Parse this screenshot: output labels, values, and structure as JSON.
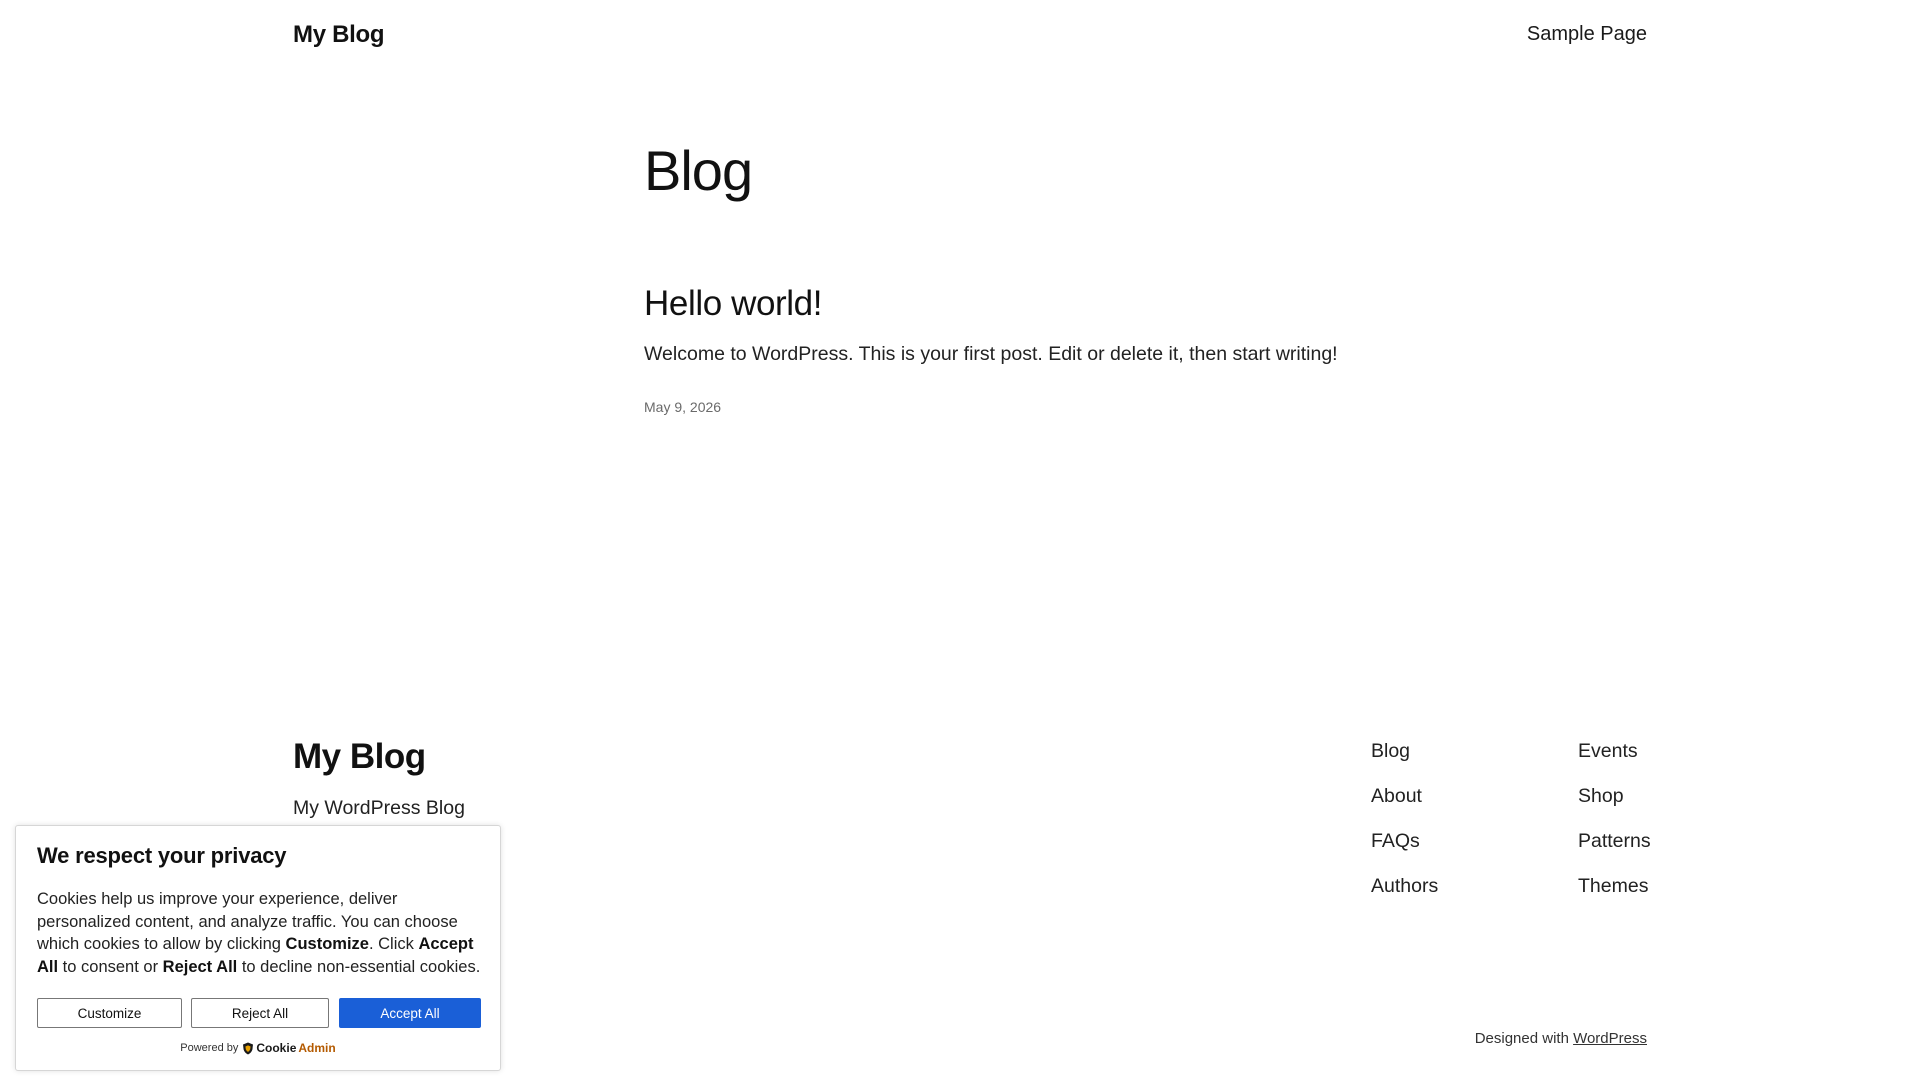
{
  "header": {
    "site_title": "My Blog",
    "nav": [
      "Sample Page"
    ]
  },
  "main": {
    "heading": "Blog",
    "post": {
      "title": "Hello world!",
      "excerpt": "Welcome to WordPress. This is your first post. Edit or delete it, then start writing!",
      "date": "May 9, 2026"
    }
  },
  "footer": {
    "site_title": "My Blog",
    "tagline": "My WordPress Blog",
    "col1": [
      "Blog",
      "About",
      "FAQs",
      "Authors"
    ],
    "col2": [
      "Events",
      "Shop",
      "Patterns",
      "Themes"
    ],
    "credits_prefix": "Designed with",
    "credits_link": "WordPress"
  },
  "cookie_banner": {
    "title": "We respect your privacy",
    "body_1": "Cookies help us improve your experience, deliver personalized content, and analyze traffic. You can choose which cookies to allow by clicking ",
    "body_customize": "Customize",
    "body_2": ". Click ",
    "body_accept": "Accept All",
    "body_3": " to consent or ",
    "body_reject": "Reject All",
    "body_4": " to decline non-essential cookies.",
    "buttons": {
      "customize": "Customize",
      "reject": "Reject All",
      "accept": "Accept All"
    },
    "powered_by": "Powered by",
    "brand_part1": "Cookie",
    "brand_part2": "Admin",
    "accent_color": "#1a5fd7"
  }
}
